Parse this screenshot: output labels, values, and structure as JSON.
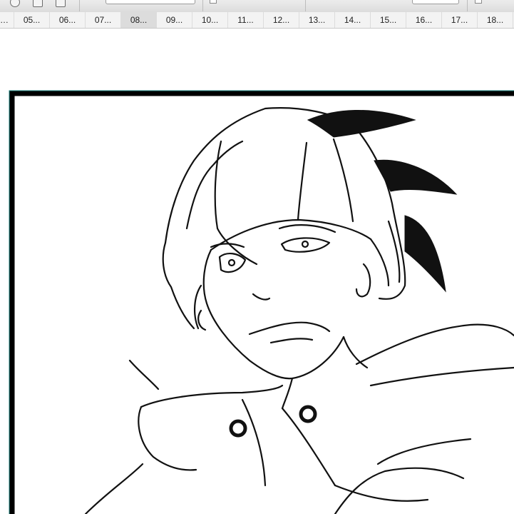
{
  "page_tabs": {
    "items": [
      {
        "label": "…"
      },
      {
        "label": "05..."
      },
      {
        "label": "06..."
      },
      {
        "label": "07..."
      },
      {
        "label": "08...",
        "active": true
      },
      {
        "label": "09..."
      },
      {
        "label": "10..."
      },
      {
        "label": "11..."
      },
      {
        "label": "12..."
      },
      {
        "label": "13..."
      },
      {
        "label": "14..."
      },
      {
        "label": "15..."
      },
      {
        "label": "16..."
      },
      {
        "label": "17..."
      },
      {
        "label": "18..."
      }
    ]
  },
  "colors": {
    "frame_border": "#000000",
    "frame_outline_accent": "#1f8a84",
    "active_tab_bg": "#dcdcdc",
    "ink": "#111111"
  },
  "icons": {
    "toolbar": [
      "rotate-icon",
      "document-icon",
      "grid-icon"
    ]
  }
}
